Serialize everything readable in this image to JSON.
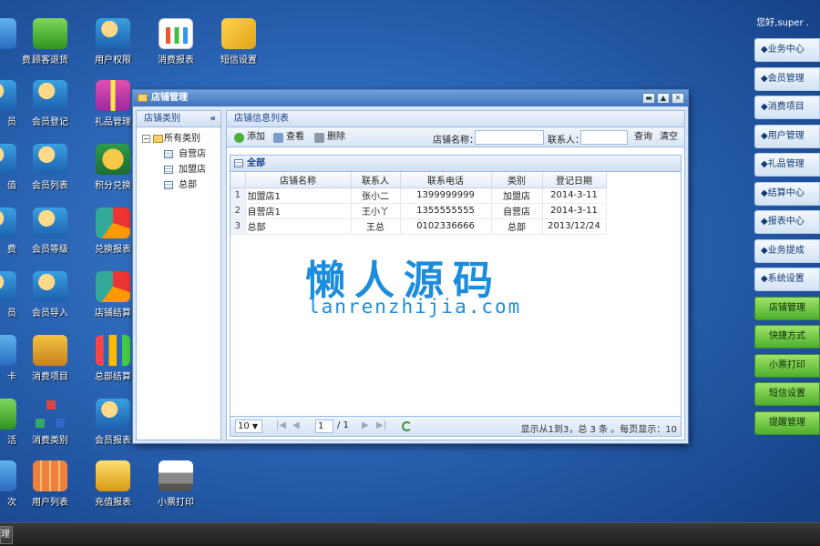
{
  "greeting": "您好,super .",
  "desktop_icons": {
    "col0": [
      "费",
      "员",
      "值",
      "费",
      "员",
      "卡",
      "活",
      "次"
    ],
    "c1r1": "顾客退货",
    "c2r1": "用户权限",
    "c3r1": "消费报表",
    "c4r1": "短信设置",
    "c1r2": "会员登记",
    "c2r2": "礼品管理",
    "c1r3": "会员列表",
    "c2r3": "积分兑换",
    "c1r4": "会员等级",
    "c2r4": "兑换报表",
    "c1r5": "会员导入",
    "c2r5": "店铺结算",
    "c1r6": "消费项目",
    "c2r6": "总部结算",
    "c1r7": "消费类别",
    "c2r7": "会员报表",
    "c1r8": "用户列表",
    "c2r8": "充值报表",
    "c3r8": "小票打印"
  },
  "right_menu": [
    {
      "label": "◆业务中心",
      "style": "blue"
    },
    {
      "label": "◆会员管理",
      "style": "blue"
    },
    {
      "label": "◆消费项目",
      "style": "blue"
    },
    {
      "label": "◆用户管理",
      "style": "blue"
    },
    {
      "label": "◆礼品管理",
      "style": "blue"
    },
    {
      "label": "◆结算中心",
      "style": "blue"
    },
    {
      "label": "◆报表中心",
      "style": "blue"
    },
    {
      "label": "◆业务提成",
      "style": "blue"
    },
    {
      "label": "◆系统设置",
      "style": "blue"
    },
    {
      "label": "店铺管理",
      "style": "green"
    },
    {
      "label": "快捷方式",
      "style": "green"
    },
    {
      "label": "小票打印",
      "style": "green"
    },
    {
      "label": "短信设置",
      "style": "green"
    },
    {
      "label": "提醒管理",
      "style": "green"
    }
  ],
  "taskbar": {
    "button": "理"
  },
  "window": {
    "title": "店铺管理",
    "left_panel": {
      "title": "店铺类别",
      "collapse": "«",
      "tree": {
        "root": "所有类别",
        "children": [
          "自营店",
          "加盟店",
          "总部"
        ]
      }
    },
    "right_panel": {
      "title": "店铺信息列表",
      "toolbar": {
        "add": "添加",
        "view": "查看",
        "delete": "删除",
        "name_label": "店铺名称：",
        "name_value": "",
        "contact_label": "联系人：",
        "contact_value": "",
        "query": "查询",
        "clear": "清空"
      },
      "grid": {
        "title": "全部",
        "columns": [
          "",
          "店铺名称",
          "联系人",
          "联系电话",
          "类别",
          "登记日期"
        ],
        "rows": [
          [
            "1",
            "加盟店1",
            "张小二",
            "1399999999",
            "加盟店",
            "2014-3-11"
          ],
          [
            "2",
            "自营店1",
            "王小丫",
            "1355555555",
            "自营店",
            "2014-3-11"
          ],
          [
            "3",
            "总部",
            "王总",
            "0102336666",
            "总部",
            "2013/12/24"
          ]
        ]
      },
      "pager": {
        "page_size": "10",
        "page": "1",
        "total_pages": "/ 1",
        "info": "显示从1到3，总 3 条 。每页显示：10"
      }
    }
  },
  "watermark": {
    "line1": "懒人源码",
    "line2": "lanrenzhijia.com"
  }
}
